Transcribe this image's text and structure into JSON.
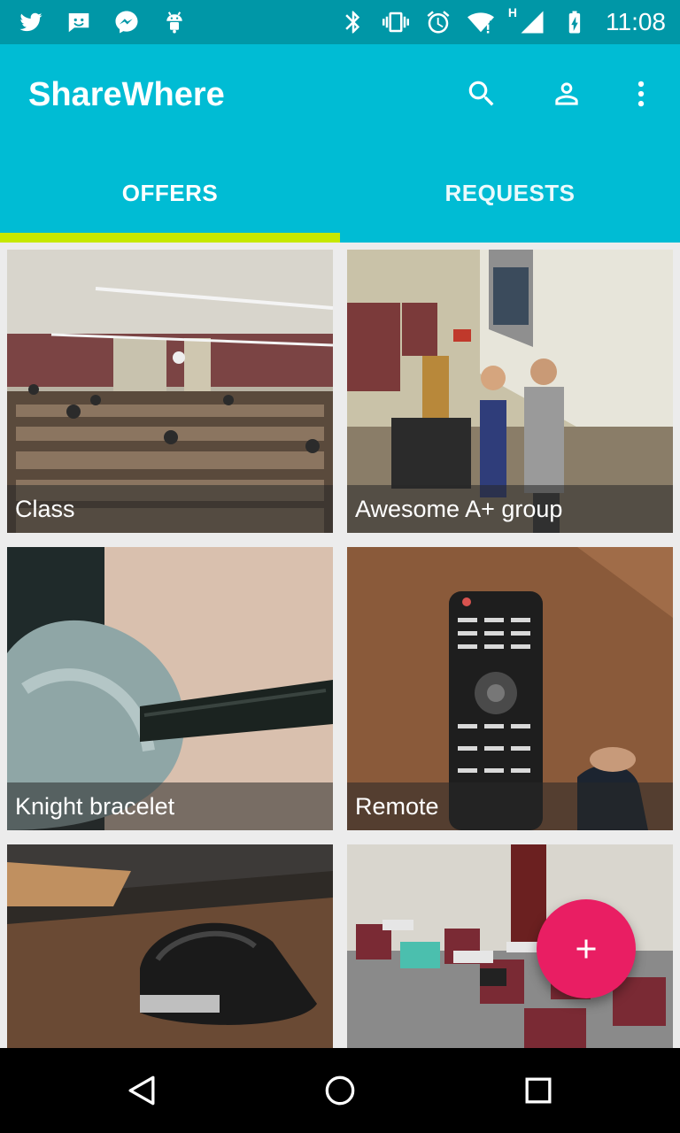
{
  "status_bar": {
    "left_icons": [
      "twitter-icon",
      "message-icon",
      "messenger-icon",
      "android-icon"
    ],
    "right_icons": [
      "bluetooth-icon",
      "vibrate-icon",
      "alarm-icon",
      "wifi-icon",
      "signal-icon",
      "battery-icon"
    ],
    "network_label": "H",
    "time": "11:08"
  },
  "app_bar": {
    "title": "ShareWhere",
    "actions": [
      "search-icon",
      "account-icon",
      "more-vert-icon"
    ],
    "color": "#00bcd4"
  },
  "tabs": [
    {
      "label": "OFFERS",
      "selected": true
    },
    {
      "label": "REQUESTS",
      "selected": false
    }
  ],
  "tab_indicator_color": "#c6e800",
  "cards": [
    {
      "caption": "Class"
    },
    {
      "caption": "Awesome A+ group"
    },
    {
      "caption": "Knight bracelet"
    },
    {
      "caption": "Remote"
    },
    {
      "caption": ""
    },
    {
      "caption": ""
    }
  ],
  "fab": {
    "icon": "plus-icon",
    "color": "#e91e63"
  },
  "nav_bar": [
    "back-icon",
    "home-icon",
    "recents-icon"
  ]
}
